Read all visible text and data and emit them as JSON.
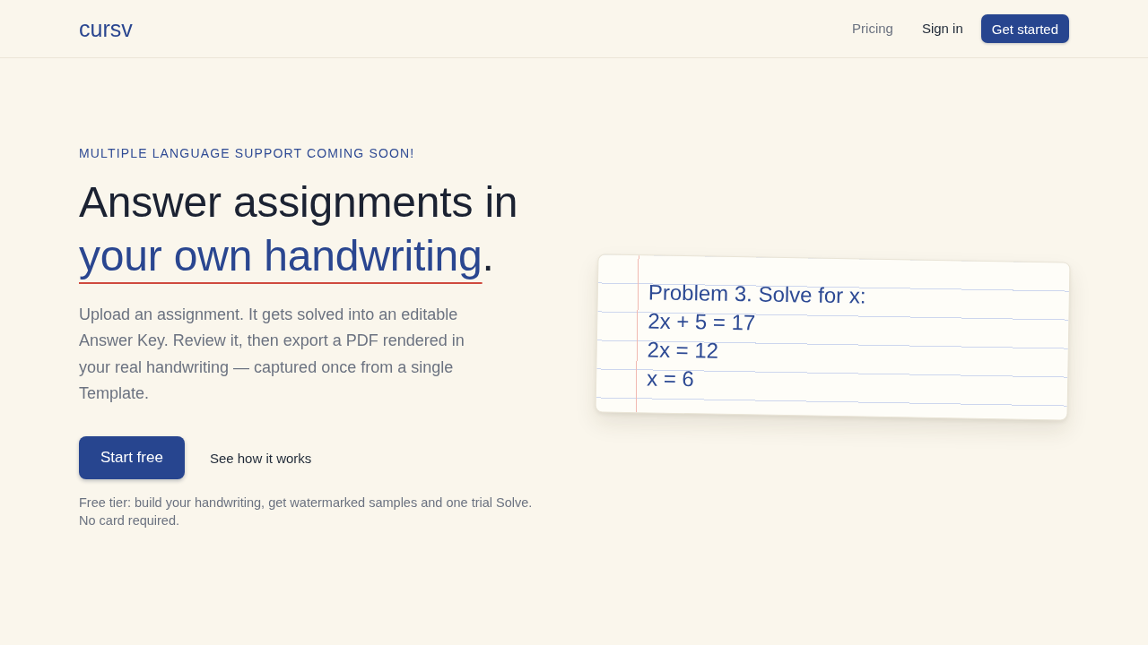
{
  "header": {
    "logo": "cursv",
    "nav": [
      {
        "label": "Pricing",
        "kind": "muted"
      },
      {
        "label": "Sign in",
        "kind": "plain"
      }
    ],
    "cta": "Get started"
  },
  "hero": {
    "eyebrow": "MULTIPLE LANGUAGE SUPPORT COMING SOON!",
    "headline": {
      "lead": "Answer assignments in",
      "highlight": "your own handwriting",
      "end": "."
    },
    "description": "Upload an assignment. It gets solved into an editable Answer Key. Review it, then export a PDF rendered in your real handwriting — captured once from a single Template.",
    "primary_button": "Start free",
    "secondary_link": "See how it works",
    "fine_print": "Free tier: build your handwriting, get watermarked samples and one trial Solve. No card required."
  },
  "notebook": {
    "lines": [
      "Problem 3. Solve for x:",
      "2x + 5 = 17",
      "2x = 12",
      "x = 6"
    ]
  }
}
